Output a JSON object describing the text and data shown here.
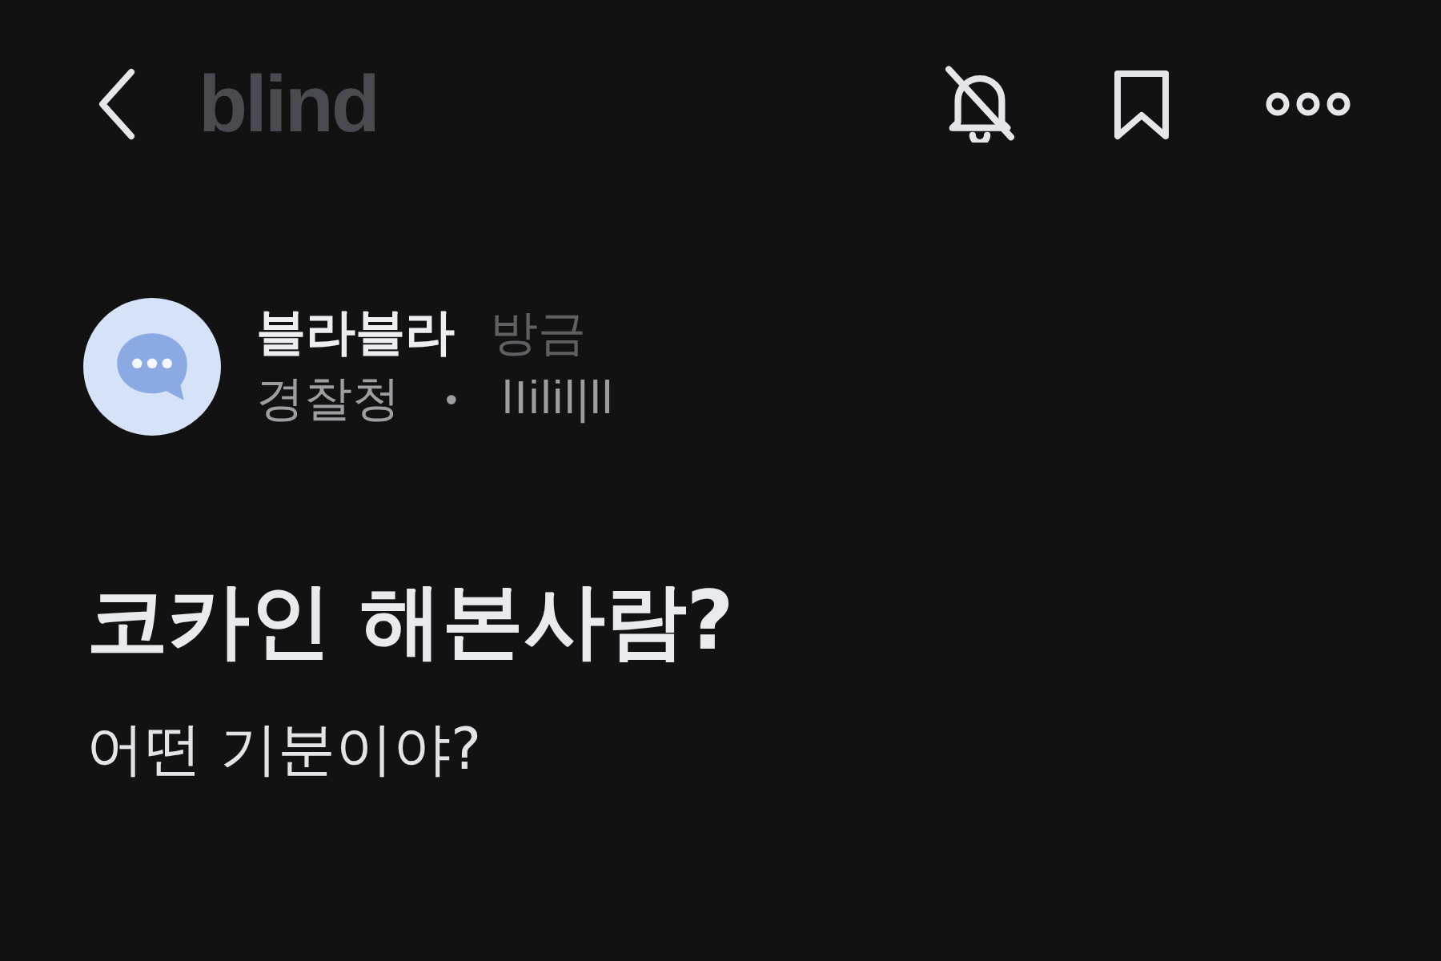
{
  "header": {
    "logo": "blind",
    "notifications_muted": true
  },
  "post": {
    "author": {
      "nickname": "블라블라",
      "time": "방금",
      "company": "경찰청",
      "separator": "•",
      "job": "lIilil|ll"
    },
    "title": "코카인 해본사람?",
    "body": "어떤 기분이야?"
  }
}
